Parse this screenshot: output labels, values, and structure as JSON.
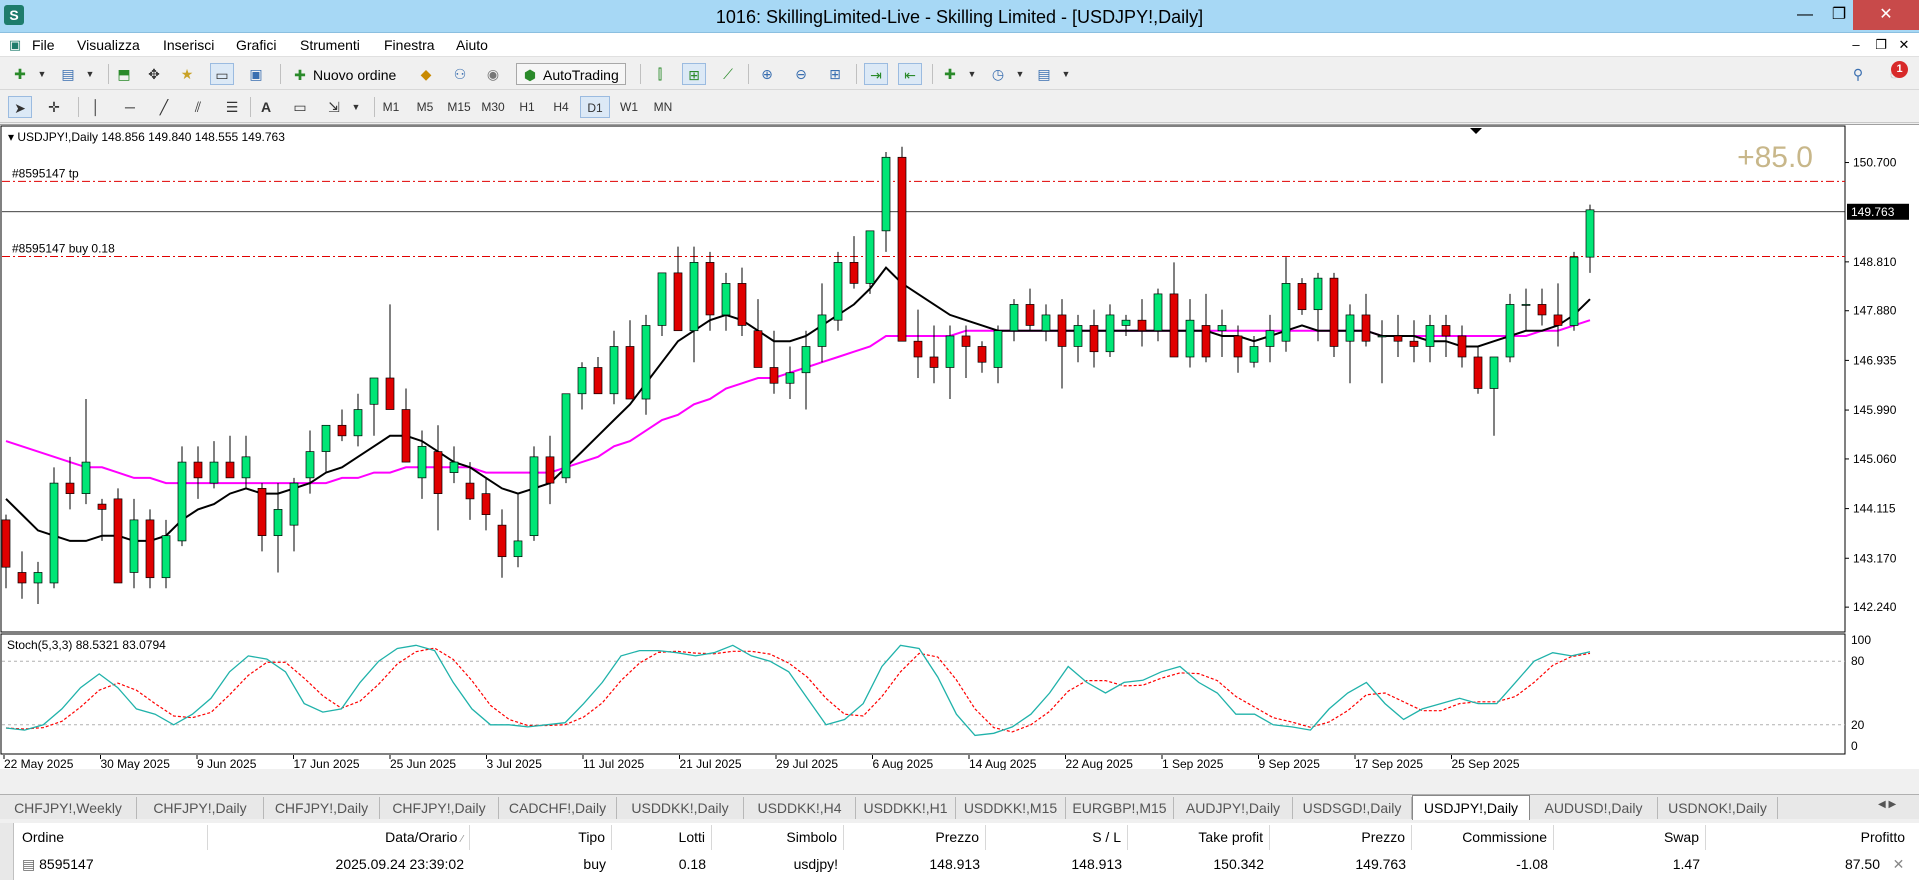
{
  "window": {
    "title": "1016: SkillingLimited-Live - Skilling Limited - [USDJPY!,Daily]",
    "app_icon": "S",
    "minimize": "—",
    "maximize": "❐",
    "close": "✕"
  },
  "menu": [
    "File",
    "Visualizza",
    "Inserisci",
    "Grafici",
    "Strumenti",
    "Finestra",
    "Aiuto"
  ],
  "toolbar": {
    "new_order": "Nuovo ordine",
    "autotrading": "AutoTrading",
    "timeframes": [
      "M1",
      "M5",
      "M15",
      "M30",
      "H1",
      "H4",
      "D1",
      "W1",
      "MN"
    ],
    "active_timeframe": "D1",
    "notification_count": "1"
  },
  "chart": {
    "header": "USDJPY!,Daily  148.856 149.840 148.555 149.763",
    "tp_label": "#8595147 tp",
    "buy_label": "#8595147 buy 0.18",
    "profit_overlay": "+85.0",
    "current_price": "149.763",
    "price_ticks": [
      "150.700",
      "148.810",
      "147.880",
      "146.935",
      "145.990",
      "145.060",
      "144.115",
      "143.170",
      "142.240"
    ],
    "stoch_label": "Stoch(5,3,3) 88.5321 83.0794",
    "stoch_ticks": [
      "100",
      "80",
      "20",
      "0"
    ],
    "date_labels": [
      "22 May 2025",
      "30 May 2025",
      "9 Jun 2025",
      "17 Jun 2025",
      "25 Jun 2025",
      "3 Jul 2025",
      "11 Jul 2025",
      "21 Jul 2025",
      "29 Jul 2025",
      "6 Aug 2025",
      "14 Aug 2025",
      "22 Aug 2025",
      "1 Sep 2025",
      "9 Sep 2025",
      "17 Sep 2025",
      "25 Sep 2025"
    ],
    "colors": {
      "bull": "#00e676",
      "bear": "#e00000",
      "ma_fast": "#000000",
      "ma_slow": "#ff00ff",
      "order_line": "#e00000",
      "stoch_main": "#20b2aa",
      "stoch_signal": "#ff0000"
    }
  },
  "chart_data": {
    "type": "candlestick",
    "symbol": "USDJPY!",
    "timeframe": "Daily",
    "ylim": [
      141.9,
      151.3
    ],
    "tp_price": 150.342,
    "entry_price": 148.913,
    "last_price": 149.763,
    "candles": [
      [
        143.9,
        144.0,
        142.6,
        143.0
      ],
      [
        142.9,
        143.3,
        142.4,
        142.7
      ],
      [
        142.7,
        143.1,
        142.3,
        142.9
      ],
      [
        142.7,
        144.9,
        142.6,
        144.6
      ],
      [
        144.6,
        145.1,
        144.1,
        144.4
      ],
      [
        144.4,
        146.2,
        144.2,
        145.0
      ],
      [
        144.2,
        144.3,
        143.5,
        144.1
      ],
      [
        144.3,
        144.5,
        142.7,
        142.7
      ],
      [
        142.9,
        144.3,
        142.6,
        143.9
      ],
      [
        143.9,
        144.1,
        142.6,
        142.8
      ],
      [
        142.8,
        143.9,
        142.6,
        143.6
      ],
      [
        143.5,
        145.3,
        143.4,
        145.0
      ],
      [
        145.0,
        145.3,
        144.3,
        144.7
      ],
      [
        144.6,
        145.4,
        144.5,
        145.0
      ],
      [
        145.0,
        145.5,
        144.7,
        144.7
      ],
      [
        144.7,
        145.5,
        144.5,
        145.1
      ],
      [
        144.5,
        144.6,
        143.3,
        143.6
      ],
      [
        143.6,
        144.6,
        142.9,
        144.1
      ],
      [
        143.8,
        144.7,
        143.3,
        144.6
      ],
      [
        144.7,
        145.6,
        144.4,
        145.2
      ],
      [
        145.2,
        145.6,
        144.8,
        145.7
      ],
      [
        145.7,
        146.0,
        145.4,
        145.5
      ],
      [
        145.5,
        146.3,
        145.3,
        146.0
      ],
      [
        146.1,
        146.5,
        145.5,
        146.6
      ],
      [
        146.6,
        148.0,
        146.2,
        146.0
      ],
      [
        146.0,
        146.4,
        145.0,
        145.0
      ],
      [
        144.7,
        145.6,
        144.3,
        145.3
      ],
      [
        145.2,
        145.7,
        143.7,
        144.4
      ],
      [
        144.8,
        145.3,
        144.6,
        145.0
      ],
      [
        144.6,
        145.0,
        143.9,
        144.3
      ],
      [
        144.4,
        144.7,
        143.7,
        144.0
      ],
      [
        143.8,
        144.1,
        142.8,
        143.2
      ],
      [
        143.2,
        144.4,
        143.0,
        143.5
      ],
      [
        143.6,
        145.3,
        143.5,
        145.1
      ],
      [
        145.1,
        145.5,
        144.2,
        144.6
      ],
      [
        144.7,
        146.3,
        144.6,
        146.3
      ],
      [
        146.3,
        146.9,
        146.0,
        146.8
      ],
      [
        146.8,
        147.0,
        146.4,
        146.3
      ],
      [
        146.3,
        147.5,
        146.1,
        147.2
      ],
      [
        147.2,
        147.7,
        146.6,
        146.2
      ],
      [
        146.2,
        147.8,
        145.9,
        147.6
      ],
      [
        147.6,
        148.6,
        147.4,
        148.6
      ],
      [
        148.6,
        149.1,
        147.5,
        147.5
      ],
      [
        147.5,
        149.1,
        146.9,
        148.8
      ],
      [
        148.8,
        149.0,
        147.5,
        147.8
      ],
      [
        147.8,
        148.6,
        147.5,
        148.4
      ],
      [
        148.4,
        148.7,
        147.4,
        147.6
      ],
      [
        147.5,
        148.1,
        146.9,
        146.8
      ],
      [
        146.8,
        147.5,
        146.3,
        146.5
      ],
      [
        146.5,
        147.2,
        146.2,
        146.7
      ],
      [
        146.7,
        147.5,
        146.0,
        147.2
      ],
      [
        147.2,
        148.4,
        146.9,
        147.8
      ],
      [
        147.7,
        149.0,
        147.5,
        148.8
      ],
      [
        148.8,
        149.3,
        148.3,
        148.4
      ],
      [
        148.4,
        149.4,
        148.2,
        149.4
      ],
      [
        149.4,
        150.9,
        149.0,
        150.8
      ],
      [
        150.8,
        151.0,
        147.4,
        147.3
      ],
      [
        147.3,
        147.9,
        146.6,
        147.0
      ],
      [
        147.0,
        147.6,
        146.5,
        146.8
      ],
      [
        146.8,
        147.6,
        146.2,
        147.4
      ],
      [
        147.4,
        147.6,
        146.6,
        147.2
      ],
      [
        147.2,
        147.3,
        146.7,
        146.9
      ],
      [
        146.8,
        147.6,
        146.5,
        147.5
      ],
      [
        147.5,
        148.1,
        147.3,
        148.0
      ],
      [
        148.0,
        148.3,
        147.5,
        147.6
      ],
      [
        147.5,
        148.0,
        147.3,
        147.8
      ],
      [
        147.8,
        148.1,
        146.4,
        147.2
      ],
      [
        147.2,
        147.8,
        146.9,
        147.6
      ],
      [
        147.6,
        147.9,
        146.8,
        147.1
      ],
      [
        147.1,
        148.0,
        147.0,
        147.8
      ],
      [
        147.6,
        147.8,
        147.4,
        147.7
      ],
      [
        147.7,
        148.1,
        147.2,
        147.5
      ],
      [
        147.5,
        148.3,
        147.3,
        148.2
      ],
      [
        148.2,
        148.8,
        147.0,
        147.0
      ],
      [
        147.0,
        148.1,
        146.8,
        147.7
      ],
      [
        147.6,
        148.2,
        146.9,
        147.0
      ],
      [
        147.5,
        147.9,
        147.0,
        147.6
      ],
      [
        147.4,
        147.6,
        146.7,
        147.0
      ],
      [
        146.9,
        147.4,
        146.8,
        147.2
      ],
      [
        147.2,
        147.8,
        146.9,
        147.5
      ],
      [
        147.3,
        148.9,
        147.1,
        148.4
      ],
      [
        148.4,
        148.5,
        147.8,
        147.9
      ],
      [
        147.9,
        148.6,
        147.3,
        148.5
      ],
      [
        148.5,
        148.6,
        147.0,
        147.2
      ],
      [
        147.3,
        148.0,
        146.5,
        147.8
      ],
      [
        147.8,
        148.2,
        147.2,
        147.3
      ],
      [
        147.4,
        147.7,
        146.5,
        147.4
      ],
      [
        147.4,
        147.8,
        147.0,
        147.3
      ],
      [
        147.3,
        147.7,
        146.9,
        147.2
      ],
      [
        147.2,
        147.8,
        146.9,
        147.6
      ],
      [
        147.6,
        147.8,
        147.0,
        147.4
      ],
      [
        147.4,
        147.6,
        146.8,
        147.0
      ],
      [
        147.0,
        147.2,
        146.3,
        146.4
      ],
      [
        146.4,
        147.0,
        145.5,
        147.0
      ],
      [
        147.0,
        148.2,
        146.9,
        148.0
      ],
      [
        148.0,
        148.3,
        147.5,
        148.0
      ],
      [
        148.0,
        148.3,
        147.6,
        147.8
      ],
      [
        147.8,
        148.4,
        147.2,
        147.6
      ],
      [
        147.6,
        149.0,
        147.5,
        148.9
      ],
      [
        148.9,
        149.9,
        148.6,
        149.8
      ]
    ],
    "ma_fast": [
      144.3,
      144.0,
      143.7,
      143.6,
      143.5,
      143.5,
      143.6,
      143.6,
      143.5,
      143.5,
      143.6,
      143.9,
      144.1,
      144.2,
      144.4,
      144.5,
      144.4,
      144.4,
      144.5,
      144.6,
      144.8,
      144.9,
      145.1,
      145.3,
      145.5,
      145.5,
      145.4,
      145.2,
      145.0,
      144.9,
      144.7,
      144.5,
      144.4,
      144.5,
      144.6,
      144.9,
      145.2,
      145.5,
      145.8,
      146.1,
      146.5,
      146.9,
      147.3,
      147.5,
      147.7,
      147.8,
      147.7,
      147.5,
      147.3,
      147.3,
      147.4,
      147.6,
      147.8,
      148.0,
      148.3,
      148.7,
      148.4,
      148.2,
      148.0,
      147.8,
      147.7,
      147.6,
      147.5,
      147.5,
      147.5,
      147.5,
      147.5,
      147.5,
      147.5,
      147.5,
      147.5,
      147.5,
      147.5,
      147.5,
      147.5,
      147.5,
      147.4,
      147.4,
      147.3,
      147.4,
      147.5,
      147.6,
      147.5,
      147.5,
      147.5,
      147.5,
      147.4,
      147.4,
      147.4,
      147.3,
      147.3,
      147.2,
      147.2,
      147.3,
      147.4,
      147.5,
      147.5,
      147.6,
      147.8,
      148.1
    ],
    "ma_slow": [
      145.4,
      145.3,
      145.2,
      145.1,
      145.0,
      144.9,
      144.9,
      144.8,
      144.7,
      144.7,
      144.6,
      144.6,
      144.6,
      144.6,
      144.6,
      144.6,
      144.6,
      144.6,
      144.6,
      144.6,
      144.6,
      144.7,
      144.7,
      144.8,
      144.8,
      144.9,
      144.9,
      144.9,
      144.9,
      144.9,
      144.8,
      144.8,
      144.8,
      144.8,
      144.8,
      144.9,
      145.0,
      145.1,
      145.3,
      145.4,
      145.6,
      145.8,
      145.9,
      146.1,
      146.2,
      146.4,
      146.5,
      146.6,
      146.6,
      146.7,
      146.8,
      146.9,
      147.0,
      147.1,
      147.2,
      147.4,
      147.4,
      147.4,
      147.4,
      147.4,
      147.5,
      147.5,
      147.5,
      147.5,
      147.5,
      147.5,
      147.5,
      147.5,
      147.5,
      147.5,
      147.5,
      147.5,
      147.5,
      147.5,
      147.5,
      147.5,
      147.5,
      147.5,
      147.5,
      147.5,
      147.5,
      147.5,
      147.5,
      147.5,
      147.5,
      147.5,
      147.4,
      147.4,
      147.4,
      147.4,
      147.4,
      147.4,
      147.4,
      147.4,
      147.4,
      147.4,
      147.5,
      147.5,
      147.6,
      147.7
    ],
    "stoch_main": [
      17,
      15,
      20,
      35,
      55,
      68,
      55,
      35,
      30,
      20,
      30,
      45,
      70,
      85,
      82,
      70,
      40,
      32,
      35,
      60,
      80,
      92,
      95,
      90,
      60,
      35,
      20,
      20,
      18,
      20,
      22,
      40,
      60,
      85,
      90,
      90,
      88,
      85,
      88,
      95,
      85,
      80,
      70,
      45,
      20,
      25,
      40,
      75,
      95,
      92,
      65,
      30,
      10,
      12,
      18,
      30,
      50,
      75,
      60,
      50,
      60,
      62,
      70,
      75,
      60,
      50,
      30,
      30,
      20,
      18,
      15,
      35,
      50,
      60,
      40,
      25,
      35,
      40,
      45,
      40,
      40,
      60,
      80,
      88,
      85,
      89
    ]
  },
  "tabs": {
    "items": [
      "CHFJPY!,Weekly",
      "CHFJPY!,Daily",
      "CHFJPY!,Daily",
      "CHFJPY!,Daily",
      "CADCHF!,Daily",
      "USDDKK!,Daily",
      "USDDKK!,H4",
      "USDDKK!,H1",
      "USDDKK!,M15",
      "EURGBP!,M15",
      "AUDJPY!,Daily",
      "USDSGD!,Daily",
      "USDJPY!,Daily",
      "AUDUSD!,Daily",
      "USDNOK!,Daily"
    ],
    "active": "USDJPY!,Daily"
  },
  "orders": {
    "columns": [
      "Ordine",
      "Data/Orario",
      "Tipo",
      "Lotti",
      "Simbolo",
      "Prezzo",
      "S / L",
      "Take profit",
      "Prezzo",
      "Commissione",
      "Swap",
      "Profitto"
    ],
    "rows": [
      {
        "ordine": "8595147",
        "data": "2025.09.24 23:39:02",
        "tipo": "buy",
        "lotti": "0.18",
        "simbolo": "usdjpy!",
        "prezzo": "148.913",
        "sl": "148.913",
        "tp": "150.342",
        "prezzo_corr": "149.763",
        "commissione": "-1.08",
        "swap": "1.47",
        "profitto": "87.50"
      }
    ]
  }
}
